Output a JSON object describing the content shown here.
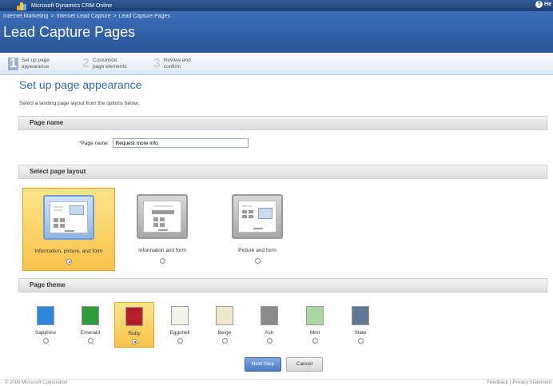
{
  "app": {
    "title": "Microsoft Dynamics CRM Online",
    "help_label": "He"
  },
  "breadcrumb": [
    "Internet Marketing",
    ">",
    "Internet Lead Capture",
    ">",
    "Lead Capture Pages"
  ],
  "page_title": "Lead Capture Pages",
  "steps": [
    {
      "num": "1",
      "label": "Set up page appearance",
      "active": true
    },
    {
      "num": "2",
      "label": "Customize page elements",
      "active": false
    },
    {
      "num": "3",
      "label": "Review and confirm",
      "active": false
    }
  ],
  "section_title": "Set up page appearance",
  "instructions": "Select a landing page layout from the options below.",
  "page_name_section": {
    "header": "Page name",
    "required_mark": "*",
    "label": "Page name:",
    "value": "Request more info"
  },
  "layout_section": {
    "header": "Select page layout",
    "options": [
      {
        "label": "Information, picture, and form",
        "selected": true
      },
      {
        "label": "Information and form",
        "selected": false
      },
      {
        "label": "Picture and form",
        "selected": false
      }
    ]
  },
  "theme_section": {
    "header": "Page theme",
    "themes": [
      {
        "label": "Sapphire",
        "color": "#2f86d9",
        "selected": false
      },
      {
        "label": "Emerald",
        "color": "#2f9a3a",
        "selected": false
      },
      {
        "label": "Ruby",
        "color": "#b51f2a",
        "selected": true
      },
      {
        "label": "Eggshell",
        "color": "#f2f1ea",
        "selected": false
      },
      {
        "label": "Beige",
        "color": "#efe7c9",
        "selected": false
      },
      {
        "label": "Ash",
        "color": "#8a8a8a",
        "selected": false
      },
      {
        "label": "Mint",
        "color": "#a8d8a0",
        "selected": false
      },
      {
        "label": "Slate",
        "color": "#5f7894",
        "selected": false
      }
    ]
  },
  "buttons": {
    "next": "Next Step",
    "cancel": "Cancel"
  },
  "footer": {
    "copyright": "© 2008 Microsoft Corporation",
    "links": [
      "Feedback",
      "|",
      "Privacy Statement"
    ]
  }
}
